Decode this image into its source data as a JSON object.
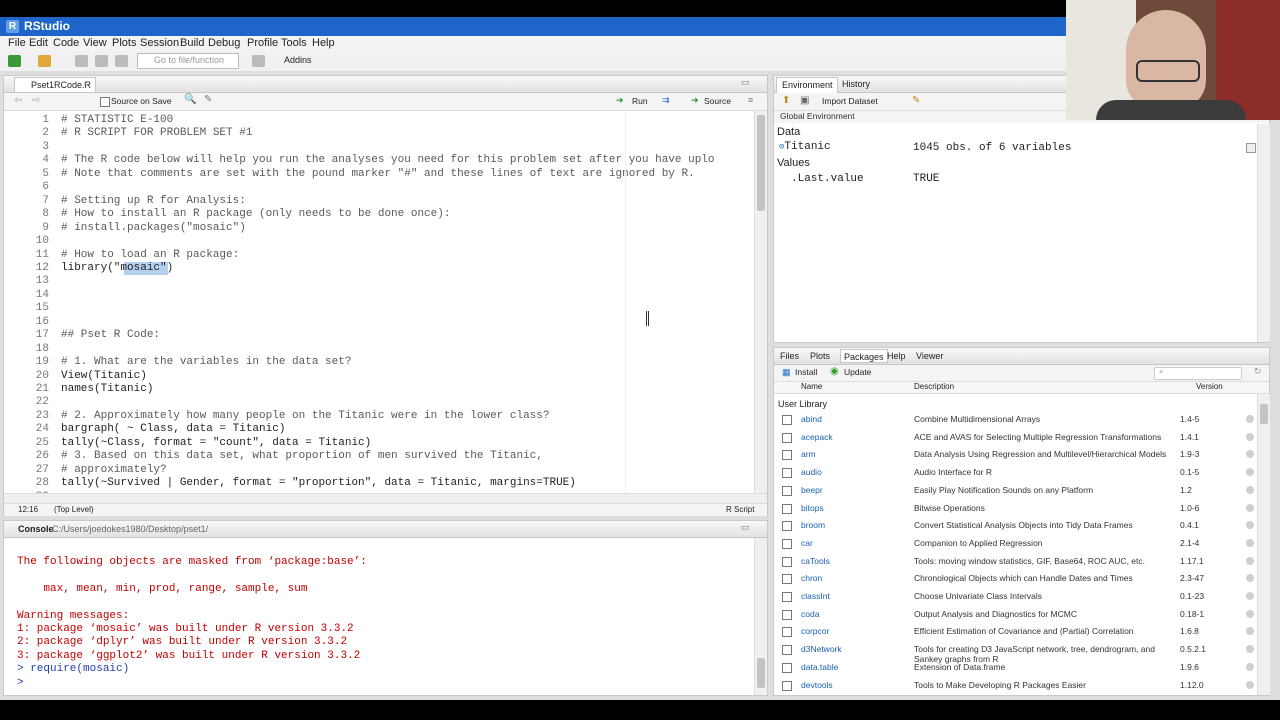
{
  "window": {
    "title": "RStudio"
  },
  "menu": [
    "File",
    "Edit",
    "Code",
    "View",
    "Plots",
    "Session",
    "Build",
    "Debug",
    "Profile",
    "Tools",
    "Help"
  ],
  "toolbar": {
    "goto_placeholder": "Go to file/function",
    "addins": "Addins"
  },
  "editor": {
    "tab": "Pset1RCode.R",
    "source_on_save": "Source on Save",
    "run": "Run",
    "source": "Source",
    "status_pos": "12:16",
    "status_level": "(Top Level)",
    "status_type": "R Script",
    "lines": [
      {
        "n": "1",
        "t": "# STATISTIC E-100",
        "c": "cmt"
      },
      {
        "n": "2",
        "t": "# R SCRIPT FOR PROBLEM SET #1",
        "c": "cmt"
      },
      {
        "n": "3",
        "t": "",
        "c": ""
      },
      {
        "n": "4",
        "t": "# The R code below will help you run the analyses you need for this problem set after you have uplo",
        "c": "cmt"
      },
      {
        "n": "5",
        "t": "# Note that comments are set with the pound marker \"#\" and these lines of text are ignored by R.",
        "c": "cmt"
      },
      {
        "n": "6",
        "t": "",
        "c": ""
      },
      {
        "n": "7",
        "t": "# Setting up R for Analysis:",
        "c": "cmt"
      },
      {
        "n": "8",
        "t": "# How to install an R package (only needs to be done once):",
        "c": "cmt"
      },
      {
        "n": "9",
        "t": "# install.packages(\"mosaic\")",
        "c": "cmt"
      },
      {
        "n": "10",
        "t": "",
        "c": ""
      },
      {
        "n": "11",
        "t": "# How to load an R package:",
        "c": "cmt"
      },
      {
        "n": "12",
        "t": "library(\"mosaic\")",
        "c": ""
      },
      {
        "n": "13",
        "t": "",
        "c": ""
      },
      {
        "n": "14",
        "t": "",
        "c": ""
      },
      {
        "n": "15",
        "t": "",
        "c": ""
      },
      {
        "n": "16",
        "t": "",
        "c": ""
      },
      {
        "n": "17",
        "t": "## Pset R Code:",
        "c": "cmt"
      },
      {
        "n": "18",
        "t": "",
        "c": ""
      },
      {
        "n": "19",
        "t": "# 1. What are the variables in the data set?",
        "c": "cmt"
      },
      {
        "n": "20",
        "t": "View(Titanic)",
        "c": ""
      },
      {
        "n": "21",
        "t": "names(Titanic)",
        "c": ""
      },
      {
        "n": "22",
        "t": "",
        "c": ""
      },
      {
        "n": "23",
        "t": "# 2. Approximately how many people on the Titanic were in the lower class?",
        "c": "cmt"
      },
      {
        "n": "24",
        "t": "bargraph( ~ Class, data = Titanic)",
        "c": ""
      },
      {
        "n": "25",
        "t": "tally(~Class, format = \"count\", data = Titanic)",
        "c": ""
      },
      {
        "n": "26",
        "t": "# 3. Based on this data set, what proportion of men survived the Titanic,",
        "c": "cmt"
      },
      {
        "n": "27",
        "t": "# approximately?",
        "c": "cmt"
      },
      {
        "n": "28",
        "t": "tally(~Survived | Gender, format = \"proportion\", data = Titanic, margins=TRUE)",
        "c": ""
      },
      {
        "n": "29",
        "t": "",
        "c": ""
      }
    ]
  },
  "console": {
    "tab": "Console",
    "path": "C:/Users/joedokes1980/Desktop/pset1/",
    "lines": [
      {
        "t": "The following objects are masked from ‘package:base’:",
        "c": "red"
      },
      {
        "t": "",
        "c": ""
      },
      {
        "t": "    max, mean, min, prod, range, sample, sum",
        "c": "red"
      },
      {
        "t": "",
        "c": ""
      },
      {
        "t": "Warning messages:",
        "c": "red"
      },
      {
        "t": "1: package ‘mosaic’ was built under R version 3.3.2",
        "c": "red"
      },
      {
        "t": "2: package ‘dplyr’ was built under R version 3.3.2",
        "c": "red"
      },
      {
        "t": "3: package ‘ggplot2’ was built under R version 3.3.2",
        "c": "red"
      },
      {
        "t": "> require(mosaic)",
        "c": "blue"
      },
      {
        "t": "> ",
        "c": "blue"
      }
    ]
  },
  "environment": {
    "tabs": [
      "Environment",
      "History"
    ],
    "import": "Import Dataset",
    "scope": "Global Environment",
    "data_header": "Data",
    "values_header": "Values",
    "data_rows": [
      {
        "name": "Titanic",
        "value": "1045 obs. of 6 variables"
      }
    ],
    "value_rows": [
      {
        "name": ".Last.value",
        "value": "TRUE"
      }
    ]
  },
  "packages_pane": {
    "tabs": [
      "Files",
      "Plots",
      "Packages",
      "Help",
      "Viewer"
    ],
    "install": "Install",
    "update": "Update",
    "cols": {
      "name": "Name",
      "desc": "Description",
      "ver": "Version"
    },
    "section": "User Library",
    "rows": [
      {
        "name": "abind",
        "desc": "Combine Multidimensional Arrays",
        "ver": "1.4-5"
      },
      {
        "name": "acepack",
        "desc": "ACE and AVAS for Selecting Multiple Regression Transformations",
        "ver": "1.4.1"
      },
      {
        "name": "arm",
        "desc": "Data Analysis Using Regression and Multilevel/Hierarchical Models",
        "ver": "1.9-3"
      },
      {
        "name": "audio",
        "desc": "Audio Interface for R",
        "ver": "0.1-5"
      },
      {
        "name": "beepr",
        "desc": "Easily Play Notification Sounds on any Platform",
        "ver": "1.2"
      },
      {
        "name": "bitops",
        "desc": "Bitwise Operations",
        "ver": "1.0-6"
      },
      {
        "name": "broom",
        "desc": "Convert Statistical Analysis Objects into Tidy Data Frames",
        "ver": "0.4.1"
      },
      {
        "name": "car",
        "desc": "Companion to Applied Regression",
        "ver": "2.1-4"
      },
      {
        "name": "caTools",
        "desc": "Tools: moving window statistics, GIF, Base64, ROC AUC, etc.",
        "ver": "1.17.1"
      },
      {
        "name": "chron",
        "desc": "Chronological Objects which can Handle Dates and Times",
        "ver": "2.3-47"
      },
      {
        "name": "classInt",
        "desc": "Choose Univariate Class Intervals",
        "ver": "0.1-23"
      },
      {
        "name": "coda",
        "desc": "Output Analysis and Diagnostics for MCMC",
        "ver": "0.18-1"
      },
      {
        "name": "corpcor",
        "desc": "Efficient Estimation of Covariance and (Partial) Correlation",
        "ver": "1.6.8"
      },
      {
        "name": "d3Network",
        "desc": "Tools for creating D3 JavaScript network, tree, dendrogram, and Sankey graphs from R",
        "ver": "0.5.2.1"
      },
      {
        "name": "data.table",
        "desc": "Extension of Data.frame",
        "ver": "1.9.6"
      },
      {
        "name": "devtools",
        "desc": "Tools to Make Developing R Packages Easier",
        "ver": "1.12.0"
      }
    ]
  }
}
